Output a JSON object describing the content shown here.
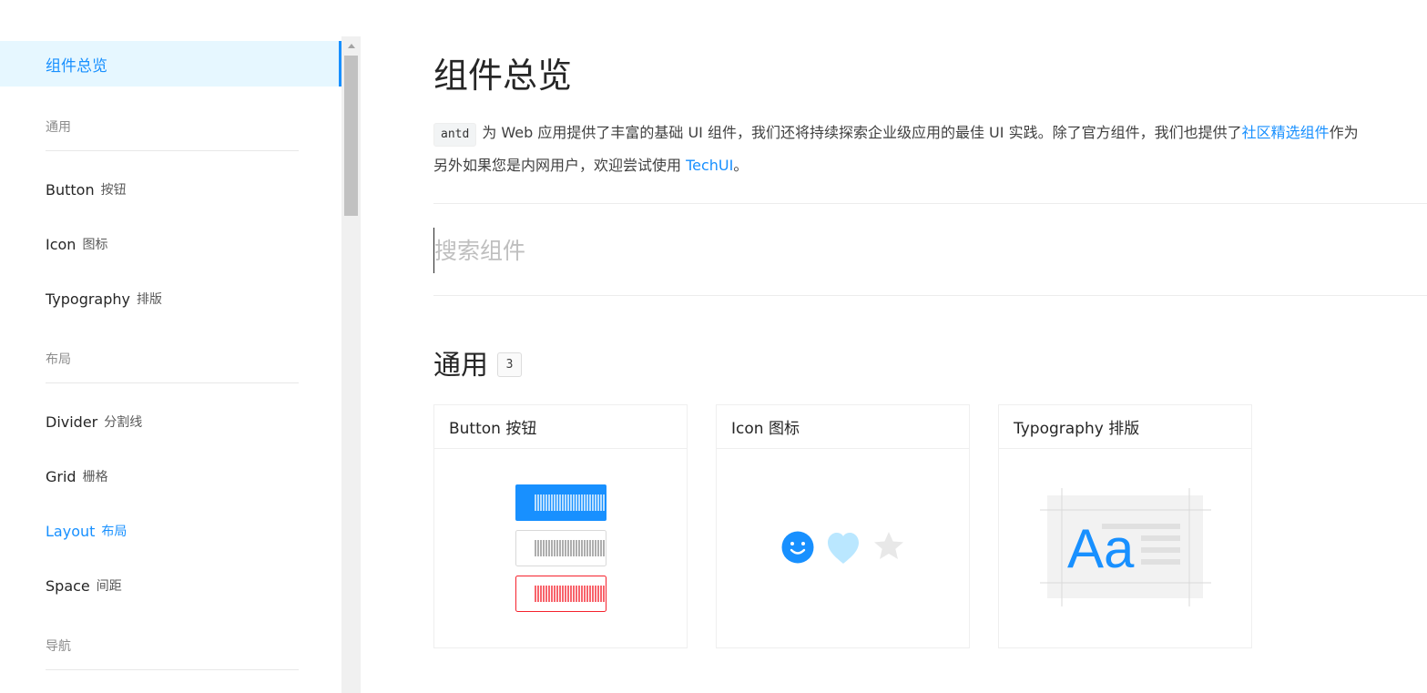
{
  "sidebar": {
    "overview": "组件总览",
    "groups": [
      {
        "title": "通用",
        "items": [
          {
            "name": "Button",
            "sub": "按钮"
          },
          {
            "name": "Icon",
            "sub": "图标"
          },
          {
            "name": "Typography",
            "sub": "排版"
          }
        ]
      },
      {
        "title": "布局",
        "items": [
          {
            "name": "Divider",
            "sub": "分割线"
          },
          {
            "name": "Grid",
            "sub": "栅格"
          },
          {
            "name": "Layout",
            "sub": "布局",
            "active": true
          },
          {
            "name": "Space",
            "sub": "间距"
          }
        ]
      },
      {
        "title": "导航",
        "items": []
      }
    ]
  },
  "main": {
    "title": "组件总览",
    "intro": {
      "code": "antd",
      "line1_text": "为 Web 应用提供了丰富的基础 UI 组件，我们还将持续探索企业级应用的最佳 UI 实践。除了官方组件，我们也提供了",
      "line1_link": "社区精选组件",
      "line1_tail": "作为",
      "line2_text": "另外如果您是内网用户，欢迎尝试使用 ",
      "line2_link": "TechUI",
      "line2_tail": "。"
    },
    "search": {
      "placeholder": "搜索组件",
      "value": ""
    },
    "section": {
      "title": "通用",
      "count": "3"
    },
    "cards": [
      {
        "title": "Button 按钮",
        "illustration": "button-illustration"
      },
      {
        "title": "Icon 图标",
        "illustration": "icon-illustration"
      },
      {
        "title": "Typography 排版",
        "illustration": "typography-illustration",
        "sample": "Aa"
      }
    ]
  },
  "colors": {
    "primary": "#1890ff",
    "danger": "#f5222d",
    "selected_bg": "#e6f7ff",
    "heart": "#bae7ff"
  }
}
